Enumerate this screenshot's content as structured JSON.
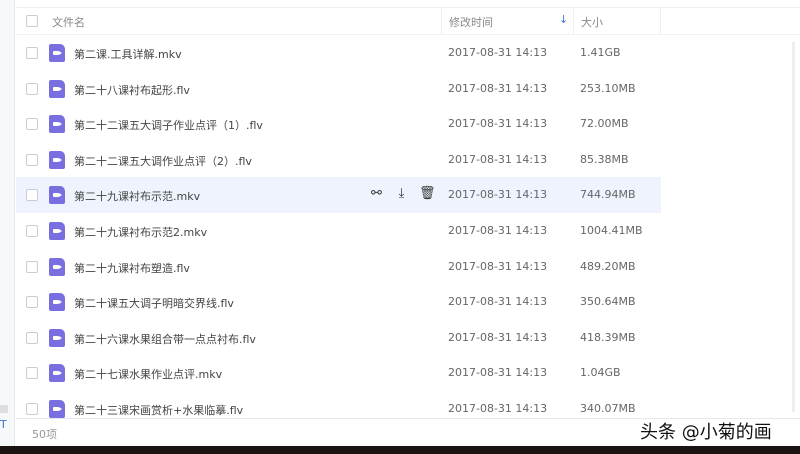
{
  "header": {
    "name": "文件名",
    "time": "修改时间",
    "sort_icon": "↓",
    "size": "大小"
  },
  "files": [
    {
      "name": "第二课.工具详解.mkv",
      "time": "2017-08-31 14:13",
      "size": "1.41GB"
    },
    {
      "name": "第二十八课衬布起形.flv",
      "time": "2017-08-31 14:13",
      "size": "253.10MB"
    },
    {
      "name": "第二十二课五大调子作业点评（1）.flv",
      "time": "2017-08-31 14:13",
      "size": "72.00MB"
    },
    {
      "name": "第二十二课五大调作业点评（2）.flv",
      "time": "2017-08-31 14:13",
      "size": "85.38MB"
    },
    {
      "name": "第二十九课衬布示范.mkv",
      "time": "2017-08-31 14:13",
      "size": "744.94MB"
    },
    {
      "name": "第二十九课衬布示范2.mkv",
      "time": "2017-08-31 14:13",
      "size": "1004.41MB"
    },
    {
      "name": "第二十九课衬布塑造.flv",
      "time": "2017-08-31 14:13",
      "size": "489.20MB"
    },
    {
      "name": "第二十课五大调子明暗交界线.flv",
      "time": "2017-08-31 14:13",
      "size": "350.64MB"
    },
    {
      "name": "第二十六课水果组合带一点点衬布.flv",
      "time": "2017-08-31 14:13",
      "size": "418.39MB"
    },
    {
      "name": "第二十七课水果作业点评.mkv",
      "time": "2017-08-31 14:13",
      "size": "1.04GB"
    },
    {
      "name": "第二十三课宋画赏析+水果临摹.flv",
      "time": "2017-08-31 14:13",
      "size": "340.07MB"
    }
  ],
  "footer": {
    "count": "50项"
  },
  "sidebar_fragment": "T",
  "watermark": "头条 @小菊的画",
  "colors": {
    "accent": "#3b7ad6",
    "file_icon": "#7a6fe0",
    "hover": "#eef3fd"
  }
}
